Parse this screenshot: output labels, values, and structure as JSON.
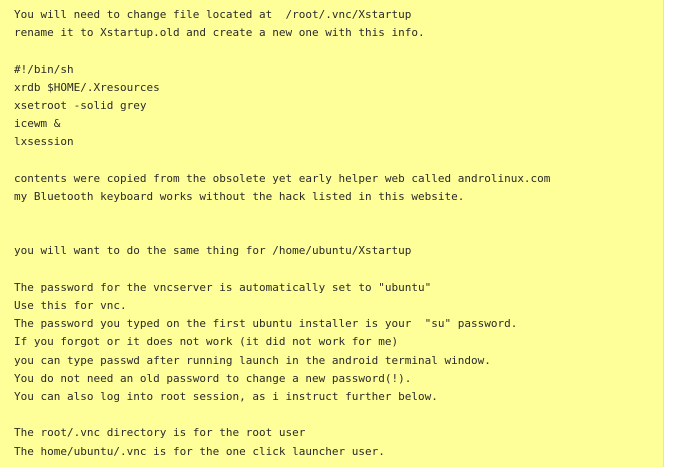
{
  "note": {
    "lines": [
      "You will need to change file located at  /root/.vnc/Xstartup",
      "rename it to Xstartup.old and create a new one with this info.",
      "",
      "#!/bin/sh",
      "xrdb $HOME/.Xresources",
      "xsetroot -solid grey",
      "icewm &",
      "lxsession",
      "",
      "contents were copied from the obsolete yet early helper web called androlinux.com",
      "my Bluetooth keyboard works without the hack listed in this website.",
      "",
      "",
      "you will want to do the same thing for /home/ubuntu/Xstartup",
      "",
      "The password for the vncserver is automatically set to \"ubuntu\"",
      "Use this for vnc.",
      "The password you typed on the first ubuntu installer is your  \"su\" password.",
      "If you forgot or it does not work (it did not work for me)",
      "you can type passwd after running launch in the android terminal window.",
      "You do not need an old password to change a new password(!).",
      "You can also log into root session, as i instruct further below.",
      "",
      "The root/.vnc directory is for the root user",
      "The home/ubuntu/.vnc is for the one click launcher user."
    ]
  },
  "colors": {
    "panel_background": "#ffff99",
    "text": "#2a2a2a"
  }
}
